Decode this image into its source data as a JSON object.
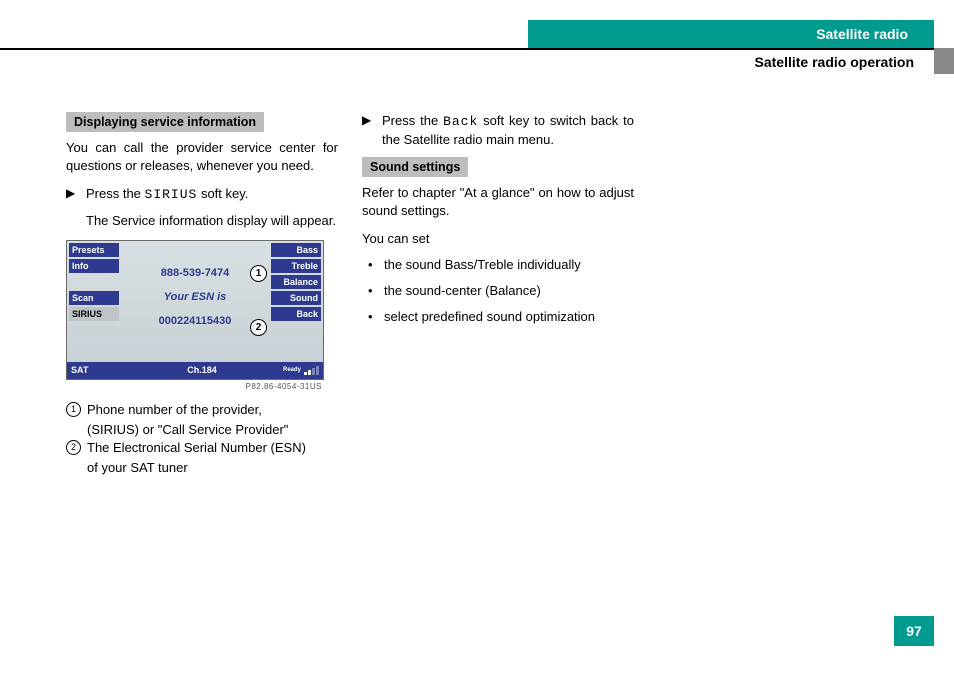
{
  "header": {
    "chapter": "Satellite radio",
    "section": "Satellite radio operation"
  },
  "page_number": "97",
  "col1": {
    "heading": "Displaying service information",
    "intro": "You can call the provider service center for questions or releases, whenever you need.",
    "step1_pre": "Press the ",
    "step1_key": "SIRIUS",
    "step1_post": " soft key.",
    "step1_result": "The Service information display will appear.",
    "legend1_a": "Phone number of the provider,",
    "legend1_b": "(SIRIUS) or \"Call Service Provider\"",
    "legend2_a": "The Electronical Serial Number (ESN)",
    "legend2_b": "of your SAT tuner"
  },
  "device": {
    "left_buttons": [
      "Presets",
      "Info",
      "",
      "Scan",
      "SIRIUS"
    ],
    "right_buttons": [
      "Bass",
      "Treble",
      "Balance",
      "Sound",
      "Back"
    ],
    "phone": "888-539-7474",
    "esn_label": "Your ESN is",
    "esn_value": "000224115430",
    "status_mode": "SAT",
    "status_channel": "Ch.184",
    "status_ready": "Ready",
    "fig_code": "P82.86-4054-31US"
  },
  "col2": {
    "step_back_pre": "Press the ",
    "step_back_key": "Back",
    "step_back_post": " soft key to switch back to the Satellite radio main menu.",
    "heading2": "Sound settings",
    "para1": "Refer to chapter \"At a glance\" on how to adjust sound settings.",
    "para2": "You can set",
    "bullets": [
      "the sound Bass/Treble individually",
      "the sound-center (Balance)",
      "select predefined sound optimization"
    ]
  }
}
